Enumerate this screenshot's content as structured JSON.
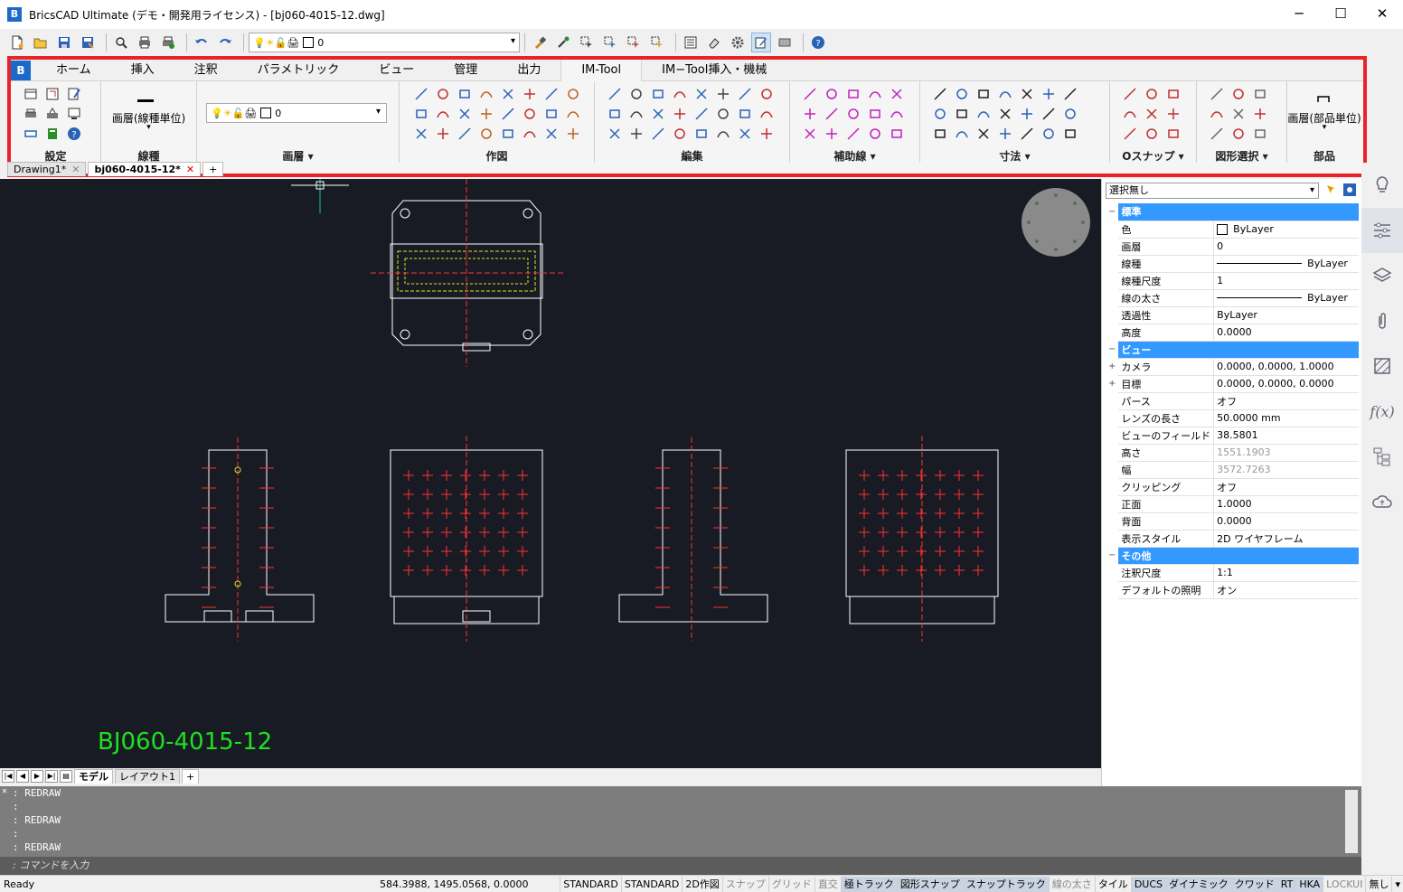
{
  "window": {
    "title": "BricsCAD Ultimate (デモ・開発用ライセンス) - [bj060-4015-12.dwg]",
    "minimize": "─",
    "maximize": "☐",
    "close": "✕"
  },
  "qat": {
    "layer_value": "0"
  },
  "ribbon": {
    "tabs": [
      "ホーム",
      "挿入",
      "注釈",
      "パラメトリック",
      "ビュー",
      "管理",
      "出力",
      "IM-Tool",
      "IM−Tool挿入・機械"
    ],
    "active_tab": "IM-Tool",
    "panels": {
      "settings": "設定",
      "linetype": "線種",
      "linetype_button": "画層(線種単位)",
      "layer": "画層",
      "layer_combo_value": "0",
      "draw": "作図",
      "edit": "編集",
      "aux": "補助線",
      "dim": "寸法",
      "osnap": "Oスナップ",
      "selection": "図形選択",
      "parts": "部品",
      "parts_button": "画層(部品単位)"
    },
    "dropdown_marker": "▾"
  },
  "doc_tabs": [
    {
      "label": "Drawing1*",
      "active": false
    },
    {
      "label": "bj060-4015-12*",
      "active": true
    }
  ],
  "doc_tab_add": "+",
  "drawing": {
    "label": "BJ060-4015-12",
    "accent_color": "#20e020",
    "line_color": "#ffffff",
    "centerline_color": "#ff2020"
  },
  "layout_tabs": {
    "model": "モデル",
    "layout1": "レイアウト1",
    "add": "+"
  },
  "command": {
    "history": [
      ":  REDRAW",
      ":",
      ":  REDRAW",
      ":",
      ":  REDRAW"
    ],
    "prompt": ":  コマンドを入力"
  },
  "status": {
    "ready": "Ready",
    "coords": "584.3988, 1495.0568, 0.0000",
    "items": [
      {
        "label": "STANDARD",
        "state": "plain"
      },
      {
        "label": "STANDARD",
        "state": "plain"
      },
      {
        "label": "2D作図",
        "state": "plain"
      },
      {
        "label": "スナップ",
        "state": "off"
      },
      {
        "label": "グリッド",
        "state": "off"
      },
      {
        "label": "直交",
        "state": "off"
      },
      {
        "label": "極トラック",
        "state": "on"
      },
      {
        "label": "図形スナップ",
        "state": "on"
      },
      {
        "label": "スナップトラック",
        "state": "on"
      },
      {
        "label": "線の太さ",
        "state": "off"
      },
      {
        "label": "タイル",
        "state": "plain"
      },
      {
        "label": "DUCS",
        "state": "on"
      },
      {
        "label": "ダイナミック",
        "state": "on"
      },
      {
        "label": "クワッド",
        "state": "on"
      },
      {
        "label": "RT",
        "state": "on"
      },
      {
        "label": "HKA",
        "state": "on"
      },
      {
        "label": "LOCKUI",
        "state": "off"
      },
      {
        "label": "無し",
        "state": "plain"
      },
      {
        "label": "▾",
        "state": "plain"
      }
    ]
  },
  "properties": {
    "selection": "選択無し",
    "categories": [
      {
        "name": "標準",
        "rows": [
          {
            "key": "色",
            "value": "ByLayer",
            "kind": "color"
          },
          {
            "key": "画層",
            "value": "0"
          },
          {
            "key": "線種",
            "value": "ByLayer",
            "kind": "line"
          },
          {
            "key": "線種尺度",
            "value": "1"
          },
          {
            "key": "線の太さ",
            "value": "ByLayer",
            "kind": "line"
          },
          {
            "key": "透過性",
            "value": "ByLayer"
          },
          {
            "key": "高度",
            "value": "0.0000"
          }
        ]
      },
      {
        "name": "ビュー",
        "rows": [
          {
            "key": "カメラ",
            "value": "0.0000, 0.0000, 1.0000",
            "expand": "+"
          },
          {
            "key": "目標",
            "value": "0.0000, 0.0000, 0.0000",
            "expand": "+"
          },
          {
            "key": "パース",
            "value": "オフ"
          },
          {
            "key": "レンズの長さ",
            "value": "50.0000 mm"
          },
          {
            "key": "ビューのフィールド",
            "value": "38.5801"
          },
          {
            "key": "高さ",
            "value": "1551.1903",
            "gray": true
          },
          {
            "key": "幅",
            "value": "3572.7263",
            "gray": true
          },
          {
            "key": "クリッピング",
            "value": "オフ"
          },
          {
            "key": "正面",
            "value": "1.0000"
          },
          {
            "key": "背面",
            "value": "0.0000"
          },
          {
            "key": "表示スタイル",
            "value": "2D ワイヤフレーム"
          }
        ]
      },
      {
        "name": "その他",
        "rows": [
          {
            "key": "注釈尺度",
            "value": "1:1"
          },
          {
            "key": "デフォルトの照明",
            "value": "オン"
          }
        ]
      }
    ],
    "collapse_marker": "−"
  }
}
